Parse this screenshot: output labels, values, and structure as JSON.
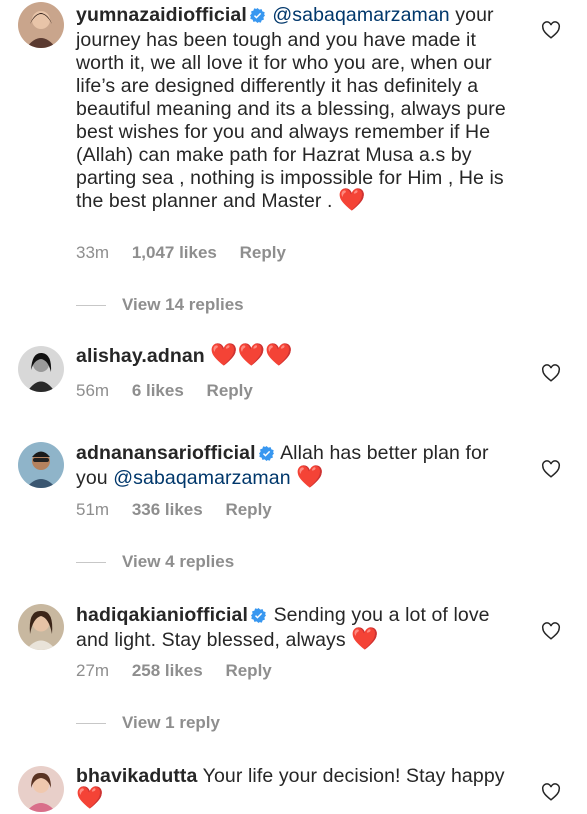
{
  "comments": [
    {
      "username": "yumnazaidiofficial",
      "verified": true,
      "mention": "@sabaqamarzaman",
      "text": "your journey has been tough and you have made it worth it, we all love it for who you are, when our life’s are designed differently it has definitely a beautiful meaning and its a blessing, always pure best wishes for you and always remember if He (Allah) can make path for Hazrat Musa a.s  by parting sea , nothing is impossible for Him , He is the best planner and Master .",
      "hearts": "❤️",
      "time": "33m",
      "likes": "1,047 likes",
      "reply": "Reply",
      "view_replies": "View 14 replies"
    },
    {
      "username": "alishay.adnan",
      "verified": false,
      "hearts": "❤️❤️❤️",
      "time": "56m",
      "likes": "6 likes",
      "reply": "Reply"
    },
    {
      "username": "adnanansariofficial",
      "verified": true,
      "text": "Allah has better plan for you",
      "mention": "@sabaqamarzaman",
      "hearts": "❤️",
      "time": "51m",
      "likes": "336 likes",
      "reply": "Reply",
      "view_replies": "View 4 replies"
    },
    {
      "username": "hadiqakianiofficial",
      "verified": true,
      "text": "Sending you a lot of love and light. Stay blessed, always",
      "hearts": "❤️",
      "time": "27m",
      "likes": "258 likes",
      "reply": "Reply",
      "view_replies": "View 1 reply"
    },
    {
      "username": "bhavikadutta",
      "verified": false,
      "text": "Your life your decision! Stay happy",
      "hearts": "❤️"
    }
  ],
  "icons": {
    "like": "heart-outline-icon",
    "verified": "verified-badge-icon"
  },
  "colors": {
    "text": "#262626",
    "secondary": "#8e8e8e",
    "mention": "#00376b",
    "verified": "#3897f0",
    "heart": "#ed1d35"
  }
}
